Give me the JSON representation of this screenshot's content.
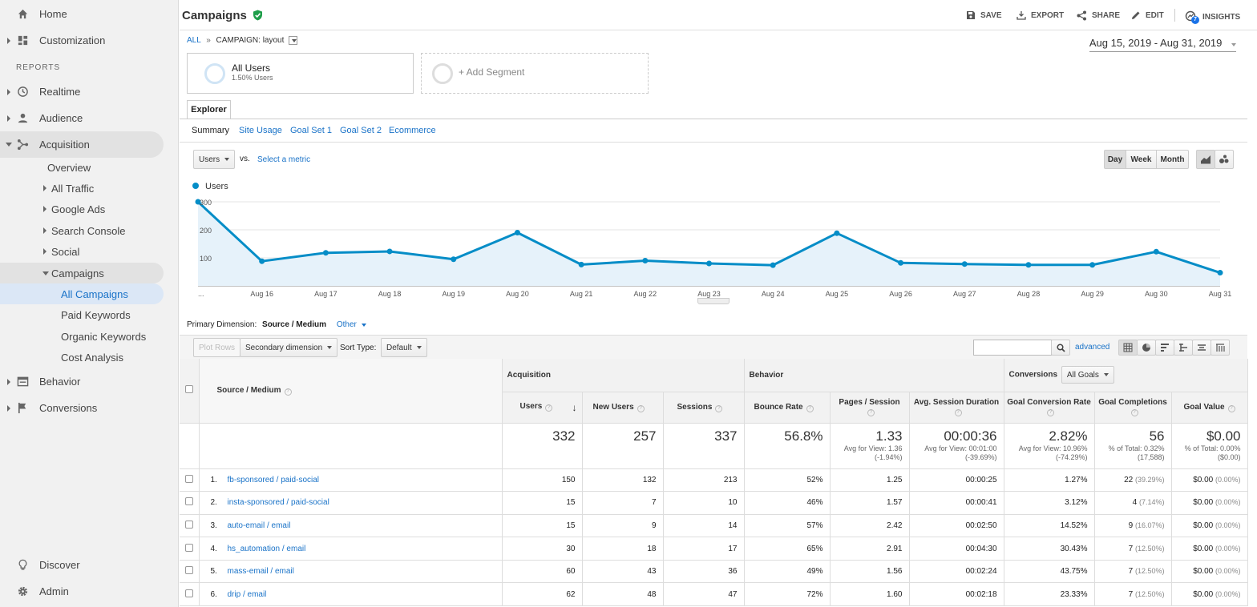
{
  "sidebar": {
    "home": "Home",
    "customization": "Customization",
    "reports_label": "REPORTS",
    "realtime": "Realtime",
    "audience": "Audience",
    "acquisition": "Acquisition",
    "overview": "Overview",
    "all_traffic": "All Traffic",
    "google_ads": "Google Ads",
    "search_console": "Search Console",
    "social": "Social",
    "campaigns": "Campaigns",
    "all_campaigns": "All Campaigns",
    "paid_keywords": "Paid Keywords",
    "organic_keywords": "Organic Keywords",
    "cost_analysis": "Cost Analysis",
    "behavior": "Behavior",
    "conversions": "Conversions",
    "discover": "Discover",
    "admin": "Admin"
  },
  "header": {
    "title": "Campaigns",
    "save": "SAVE",
    "export": "EXPORT",
    "share": "SHARE",
    "edit": "EDIT",
    "insights": "INSIGHTS",
    "insights_count": "7"
  },
  "breadcrumb": {
    "all": "ALL",
    "sep": "»",
    "current": "CAMPAIGN: layout"
  },
  "date_range": "Aug 15, 2019 - Aug 31, 2019",
  "segments": {
    "name": "All Users",
    "sub": "1.50% Users",
    "add": "+ Add Segment"
  },
  "explorer": {
    "tab": "Explorer",
    "subtabs": [
      "Summary",
      "Site Usage",
      "Goal Set 1",
      "Goal Set 2",
      "Ecommerce"
    ],
    "metric": "Users",
    "vs": "vs.",
    "select_metric": "Select a metric",
    "periods": [
      "Day",
      "Week",
      "Month"
    ]
  },
  "chart_data": {
    "type": "area",
    "series": [
      {
        "name": "Users",
        "values": [
          300,
          88,
          118,
          123,
          95,
          190,
          76,
          90,
          80,
          74,
          188,
          82,
          78,
          75,
          75,
          122,
          47
        ]
      }
    ],
    "x": [
      "...",
      "Aug 16",
      "Aug 17",
      "Aug 18",
      "Aug 19",
      "Aug 20",
      "Aug 21",
      "Aug 22",
      "Aug 23",
      "Aug 24",
      "Aug 25",
      "Aug 26",
      "Aug 27",
      "Aug 28",
      "Aug 29",
      "Aug 30",
      "Aug 31"
    ],
    "yticks": [
      "100",
      "200",
      "300"
    ],
    "ylim": [
      0,
      300
    ],
    "color": "#058dc7",
    "fill": "#e6f2fa",
    "grid": true,
    "legend": "top-left"
  },
  "table_controls": {
    "primary_label": "Primary Dimension:",
    "primary_value": "Source / Medium",
    "other": "Other",
    "plot_rows": "Plot Rows",
    "secondary": "Secondary dimension",
    "sort_label": "Sort Type:",
    "sort_value": "Default",
    "advanced": "advanced"
  },
  "table": {
    "dim_header": "Source / Medium",
    "groups": {
      "acquisition": "Acquisition",
      "behavior": "Behavior",
      "conversions": "Conversions",
      "goals": "All Goals"
    },
    "columns": [
      "Users",
      "New Users",
      "Sessions",
      "Bounce Rate",
      "Pages / Session",
      "Avg. Session Duration",
      "Goal Conversion Rate",
      "Goal Completions",
      "Goal Value"
    ],
    "totals": {
      "users": "332",
      "new_users": "257",
      "sessions": "337",
      "bounce": "56.8%",
      "pages": "1.33",
      "pages_sub": "Avg for View: 1.36 (-1.94%)",
      "duration": "00:00:36",
      "duration_sub": "Avg for View: 00:01:00 (-39.69%)",
      "conv_rate": "2.82%",
      "conv_rate_sub": "Avg for View: 10.96% (-74.29%)",
      "completions": "56",
      "completions_sub": "% of Total: 0.32% (17,588)",
      "value": "$0.00",
      "value_sub": "% of Total: 0.00% ($0.00)"
    },
    "rows": [
      {
        "idx": "1.",
        "name": "fb-sponsored / paid-social",
        "users": "150",
        "new_users": "132",
        "sessions": "213",
        "bounce": "52%",
        "pages": "1.25",
        "duration": "00:00:25",
        "conv": "1.27%",
        "comp": "22",
        "comp_pct": "(39.29%)",
        "value": "$0.00",
        "value_pct": "(0.00%)"
      },
      {
        "idx": "2.",
        "name": "insta-sponsored / paid-social",
        "users": "15",
        "new_users": "7",
        "sessions": "10",
        "bounce": "46%",
        "pages": "1.57",
        "duration": "00:00:41",
        "conv": "3.12%",
        "comp": "4",
        "comp_pct": "(7.14%)",
        "value": "$0.00",
        "value_pct": "(0.00%)"
      },
      {
        "idx": "3.",
        "name": "auto-email / email",
        "users": "15",
        "new_users": "9",
        "sessions": "14",
        "bounce": "57%",
        "pages": "2.42",
        "duration": "00:02:50",
        "conv": "14.52%",
        "comp": "9",
        "comp_pct": "(16.07%)",
        "value": "$0.00",
        "value_pct": "(0.00%)"
      },
      {
        "idx": "4.",
        "name": "hs_automation / email",
        "users": "30",
        "new_users": "18",
        "sessions": "17",
        "bounce": "65%",
        "pages": "2.91",
        "duration": "00:04:30",
        "conv": "30.43%",
        "comp": "7",
        "comp_pct": "(12.50%)",
        "value": "$0.00",
        "value_pct": "(0.00%)"
      },
      {
        "idx": "5.",
        "name": "mass-email / email",
        "users": "60",
        "new_users": "43",
        "sessions": "36",
        "bounce": "49%",
        "pages": "1.56",
        "duration": "00:02:24",
        "conv": "43.75%",
        "comp": "7",
        "comp_pct": "(12.50%)",
        "value": "$0.00",
        "value_pct": "(0.00%)"
      },
      {
        "idx": "6.",
        "name": "drip / email",
        "users": "62",
        "new_users": "48",
        "sessions": "47",
        "bounce": "72%",
        "pages": "1.60",
        "duration": "00:02:18",
        "conv": "23.33%",
        "comp": "7",
        "comp_pct": "(12.50%)",
        "value": "$0.00",
        "value_pct": "(0.00%)"
      }
    ]
  }
}
